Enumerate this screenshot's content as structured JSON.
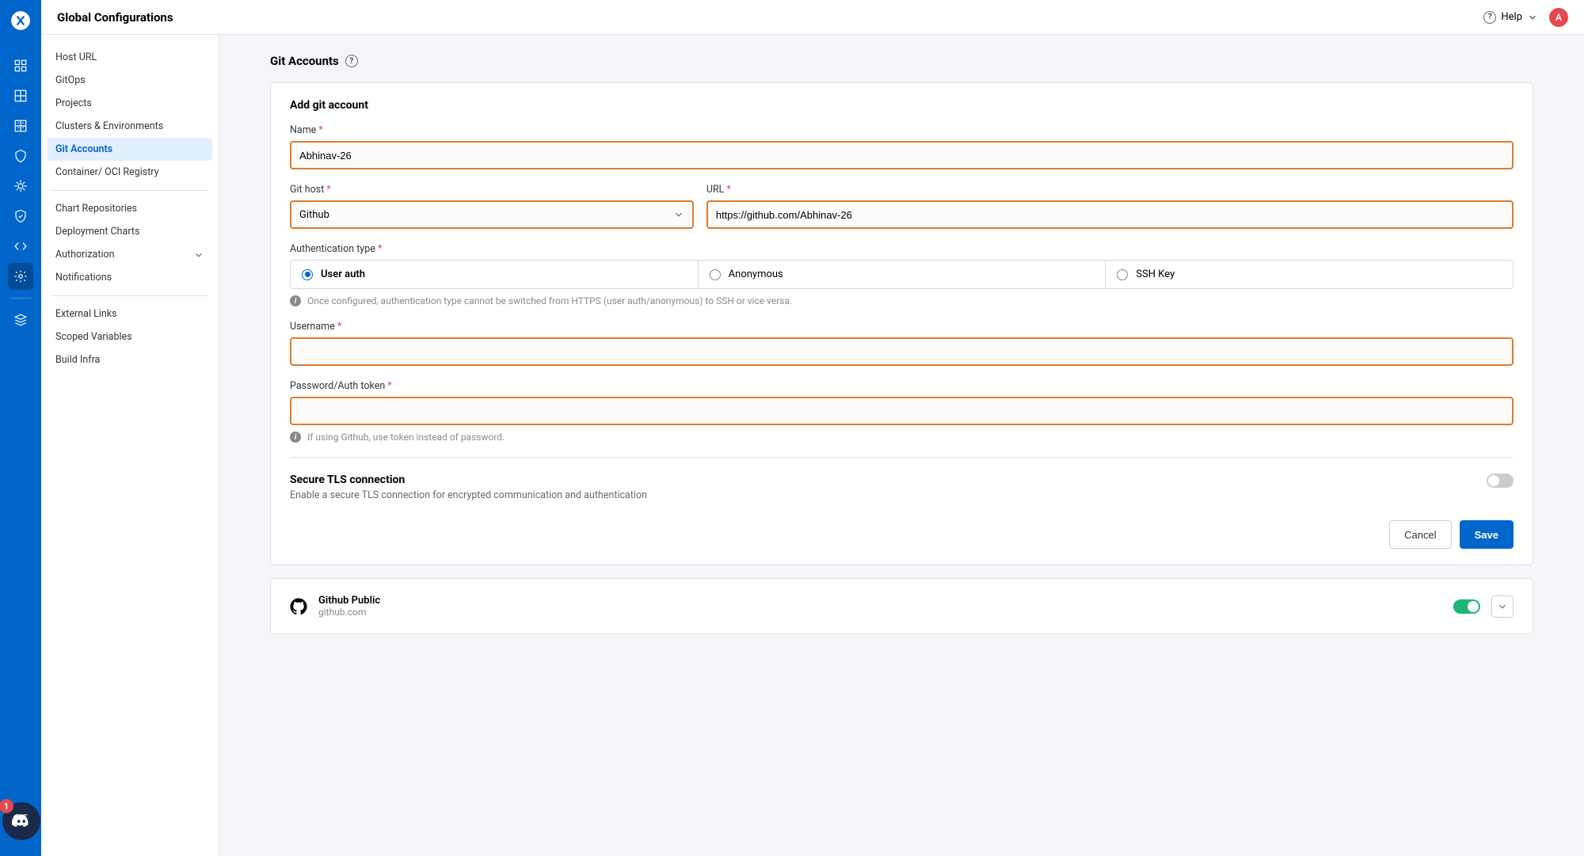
{
  "header": {
    "title": "Global Configurations",
    "help_label": "Help",
    "avatar_initial": "A"
  },
  "discord_badge": "1",
  "sidebar": {
    "items": [
      {
        "label": "Host URL"
      },
      {
        "label": "GitOps"
      },
      {
        "label": "Projects"
      },
      {
        "label": "Clusters & Environments"
      },
      {
        "label": "Git Accounts",
        "active": true
      },
      {
        "label": "Container/ OCI Registry"
      }
    ],
    "items2": [
      {
        "label": "Chart Repositories"
      },
      {
        "label": "Deployment Charts"
      },
      {
        "label": "Authorization",
        "expandable": true
      },
      {
        "label": "Notifications"
      }
    ],
    "items3": [
      {
        "label": "External Links"
      },
      {
        "label": "Scoped Variables"
      },
      {
        "label": "Build Infra"
      }
    ]
  },
  "page": {
    "title": "Git Accounts"
  },
  "form": {
    "heading": "Add git account",
    "name_label": "Name",
    "name_value": "Abhinav-26",
    "git_host_label": "Git host",
    "git_host_value": "Github",
    "url_label": "URL",
    "url_value": "https://github.com/Abhinav-26",
    "auth_type_label": "Authentication type",
    "auth_options": {
      "user_auth": "User auth",
      "anonymous": "Anonymous",
      "ssh_key": "SSH Key"
    },
    "auth_info": "Once configured, authentication type cannot be switched from HTTPS (user auth/anonymous) to SSH or vice versa.",
    "username_label": "Username",
    "username_value": "",
    "password_label": "Password/Auth token",
    "password_value": "",
    "password_info": "If using Github, use token instead of password.",
    "tls_title": "Secure TLS connection",
    "tls_sub": "Enable a secure TLS connection for encrypted communication and authentication",
    "cancel_label": "Cancel",
    "save_label": "Save"
  },
  "list": {
    "item_name": "Github Public",
    "item_sub": "github.com"
  }
}
